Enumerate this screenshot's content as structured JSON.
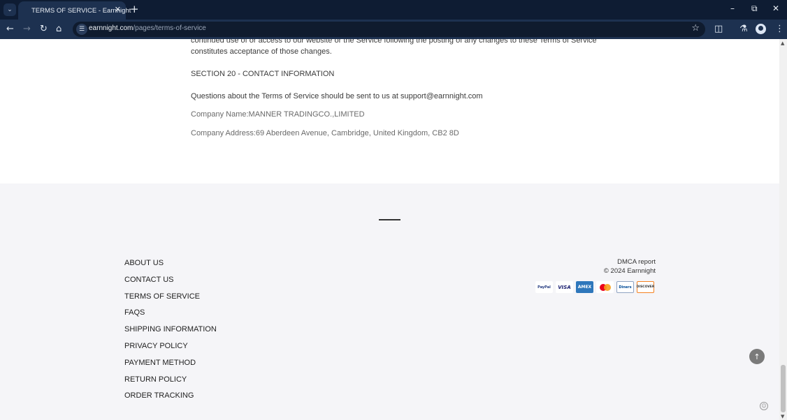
{
  "browser": {
    "tab_title": "TERMS OF SERVICE - Earnnight",
    "url_domain": "earnnight.com",
    "url_path": "/pages/terms-of-service",
    "icons": {
      "tab_list": "chevron-down-icon",
      "tab_close": "close-icon",
      "new_tab": "plus-icon",
      "minimize": "minimize-icon",
      "restore": "restore-icon",
      "close_window": "close-icon",
      "back": "arrow-left-icon",
      "forward": "arrow-right-icon",
      "reload": "reload-icon",
      "home": "home-icon",
      "site_info": "tune-icon",
      "bookmark": "star-icon",
      "extensions": "puzzle-icon",
      "labs": "flask-icon",
      "profile": "avatar-icon",
      "menu": "kebab-icon"
    }
  },
  "content": {
    "paragraph_tail_1": "continued use of or access to our website or the Service following the posting of any changes to these Terms of Service",
    "paragraph_tail_2": "constitutes acceptance of those changes.",
    "section_heading": "SECTION 20 - CONTACT INFORMATION",
    "contact_line": "Questions about the Terms of Service should be sent to us at support@earnnight.com",
    "company_name": "Company Name:MANNER TRADINGCO.,LIMITED",
    "company_address": "Company Address:69 Aberdeen Avenue, Cambridge, United Kingdom, CB2 8D"
  },
  "footer": {
    "links": [
      {
        "label": "ABOUT US"
      },
      {
        "label": "CONTACT US"
      },
      {
        "label": "TERMS OF SERVICE"
      },
      {
        "label": "FAQS"
      },
      {
        "label": "SHIPPING INFORMATION"
      },
      {
        "label": "PRIVACY POLICY"
      },
      {
        "label": "PAYMENT METHOD"
      },
      {
        "label": "RETURN POLICY"
      },
      {
        "label": "ORDER TRACKING"
      }
    ],
    "dmca": "DMCA report",
    "copyright": "© 2024 Earnnight",
    "payment_methods": [
      {
        "name": "PayPal",
        "label": "PayPal"
      },
      {
        "name": "Visa",
        "label": "VISA"
      },
      {
        "name": "American Express",
        "label": "AMEX"
      },
      {
        "name": "Mastercard",
        "label": ""
      },
      {
        "name": "Diners Club",
        "label": "Diners"
      },
      {
        "name": "Discover",
        "label": "DISCOVER"
      }
    ],
    "back_to_top_icon": "arrow-up-icon"
  },
  "colors": {
    "chrome_bg": "#0e1c33",
    "toolbar_bg": "#1d3150",
    "footer_bg": "#f5f5f8",
    "amex_blue": "#2e77bb",
    "visa_navy": "#1a1f71",
    "discover_orange": "#f48120"
  }
}
